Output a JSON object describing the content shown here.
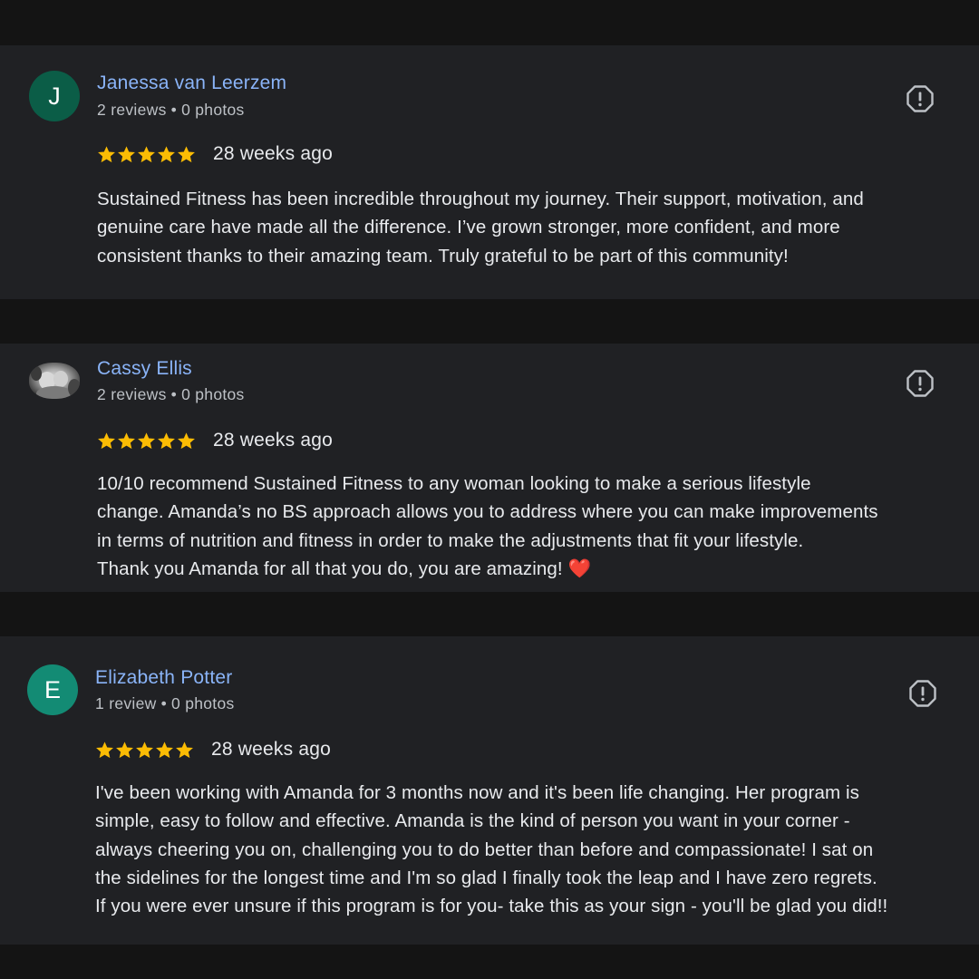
{
  "reviews": [
    {
      "name": "Janessa van Leerzem",
      "avatar_initial": "J",
      "avatar_color": "#0b5d47",
      "reviews_count": "2 reviews",
      "photos_count": "0 photos",
      "rating": 5,
      "time": "28 weeks ago",
      "lines": [
        "Sustained Fitness has been incredible throughout my journey. Their support, motivation, and",
        "genuine care have made all the difference. I’ve grown stronger, more confident, and more",
        "consistent thanks to their amazing team. Truly grateful to be part of this community!"
      ]
    },
    {
      "name": "Cassy Ellis",
      "avatar_photo": "profile-photo",
      "reviews_count": "2 reviews",
      "photos_count": "0 photos",
      "rating": 5,
      "time": "28 weeks ago",
      "lines": [
        "10/10 recommend Sustained Fitness to any woman looking to make a serious lifestyle",
        "change. Amanda’s no BS approach allows you to address where you can make improvements",
        "in terms of nutrition and fitness in order to make the adjustments that fit your lifestyle.",
        "Thank you Amanda for all that you do, you are amazing!"
      ],
      "emoji": "❤️"
    },
    {
      "name": "Elizabeth Potter",
      "avatar_initial": "E",
      "avatar_color": "#138b74",
      "reviews_count": "1 review",
      "photos_count": "0 photos",
      "rating": 5,
      "time": "28 weeks ago",
      "lines": [
        "I've been working with Amanda for 3 months now and it's been life changing. Her program is",
        "simple, easy to follow and effective. Amanda is the kind of person you want in your corner -",
        "always cheering you on, challenging you to do better than before and compassionate! I sat on",
        "the sidelines for the longest time and I'm so glad I finally took the leap and I have zero regrets.",
        "If you were ever unsure if this program is for you- take this as your sign - you'll be glad you did!!"
      ]
    }
  ],
  "separator": "•",
  "colors": {
    "background": "#141414",
    "card": "#202124",
    "name": "#8ab4f8",
    "meta": "#bdc1c6",
    "text": "#e8eaed",
    "star": "#fbbc04"
  },
  "icons": {
    "star": "star-icon",
    "flag": "report-icon",
    "emoji": "red-heart"
  }
}
